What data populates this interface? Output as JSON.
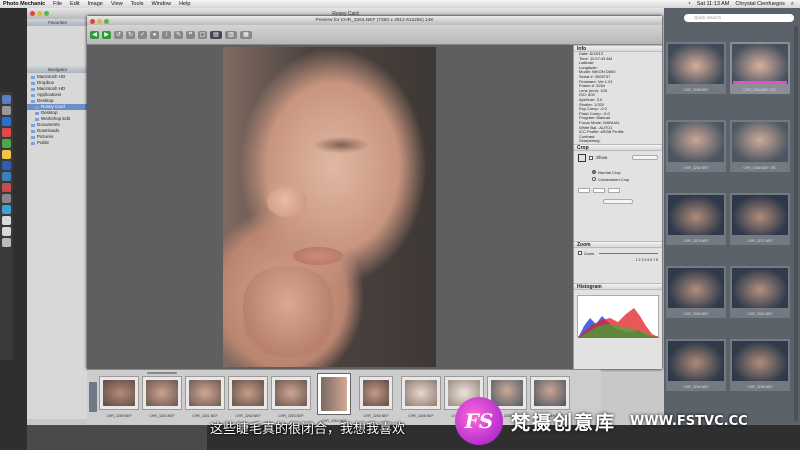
{
  "menubar": {
    "app_name": "Photo Mechanic",
    "items": [
      "File",
      "Edit",
      "Image",
      "View",
      "Tools",
      "Window",
      "Help"
    ],
    "clock": "Sat 11:13 AM",
    "user": "Chrystal Cienfuegos"
  },
  "main_window": {
    "title": "Rosey Card",
    "sidebar_header": "Favorites",
    "tree_header": "Navigator",
    "tree": [
      {
        "label": "Macintosh HD",
        "selected": false
      },
      {
        "label": "Dropbox",
        "selected": false
      },
      {
        "label": "Macintosh HD",
        "selected": false
      },
      {
        "label": "Applications",
        "selected": false
      },
      {
        "label": "Desktop",
        "selected": false
      },
      {
        "label": "Rosey Card",
        "selected": true
      },
      {
        "label": "Desktop",
        "selected": false
      },
      {
        "label": "Workshop Edit",
        "selected": false
      },
      {
        "label": "Documents",
        "selected": false
      },
      {
        "label": "Downloads",
        "selected": false
      },
      {
        "label": "Pictures",
        "selected": false
      },
      {
        "label": "Public",
        "selected": false
      }
    ]
  },
  "preview_window": {
    "title": "Preview for CHR_3264.NEF (7360 x 4912 612266) 14K"
  },
  "info_panel": {
    "header": "Info",
    "lines": [
      "Date: 8/13/13",
      "Time: 11:07:43 AM",
      "Latitude:",
      "Longitude:",
      "Model: NIKON D800",
      "Serial #: 3005737",
      "Firmware: Ver.1.01",
      "Frame #: 3264",
      "Lens (mm): 105",
      "ISO: 800",
      "Aperture: 3.0",
      "Shutter: 1/320",
      "Exp Comp: -0.0",
      "Flash Comp: -0.0",
      "Program: Manual",
      "Focus Mode: MANUAL",
      "White Bal.: AUTO1",
      "ICC Profile: sRGB Profile",
      "Contrast:",
      "Sharpening:"
    ],
    "crop_header": "Crop",
    "crop_options": [
      "Show",
      "Normal Crop",
      "Constrained Crop"
    ],
    "zoom_header": "Zoom",
    "zoom_label": "Zoom",
    "zoom_ticks": "1 2 3 4 5 6 7 8",
    "histogram_header": "Histogram"
  },
  "filmstrip": {
    "labels": [
      "CHR_3259.NEF",
      "CHR_3260.NEF",
      "CHR_3261.NEF",
      "CHR_3262.NEF",
      "CHR_3263.NEF",
      "CHR_3264.NEF",
      "CHR_3265.NEF",
      "CHR_3266.NEF",
      "CHR_3267.NEF",
      "CHR_3268.NEF",
      "CHR_3269.NEF"
    ]
  },
  "browser": {
    "search_placeholder": "Quick Search",
    "cells": [
      {
        "label": "CHR_3258.NEF",
        "selected": false
      },
      {
        "label": "CHR_3264.NEF LRC",
        "selected": true
      },
      {
        "label": "CHR_3266.NEF",
        "selected": false
      },
      {
        "label": "CHR_3268.NEF LRC",
        "selected": false
      },
      {
        "label": "CHR_3270.NEF",
        "selected": false
      },
      {
        "label": "CHR_3271.NEF",
        "selected": false
      },
      {
        "label": "CHR_3280.NEF",
        "selected": false
      },
      {
        "label": "CHR_3281.NEF",
        "selected": false
      },
      {
        "label": "CHR_3290.NEF",
        "selected": false
      },
      {
        "label": "CHR_3295.NEF",
        "selected": false
      }
    ]
  },
  "overlay": {
    "subtitle": "这些睫毛真的很闭合，我想我喜欢",
    "watermark_name": "梵摄创意库",
    "watermark_url": "WWW.FSTVC.CC",
    "watermark_logo": "FS"
  }
}
